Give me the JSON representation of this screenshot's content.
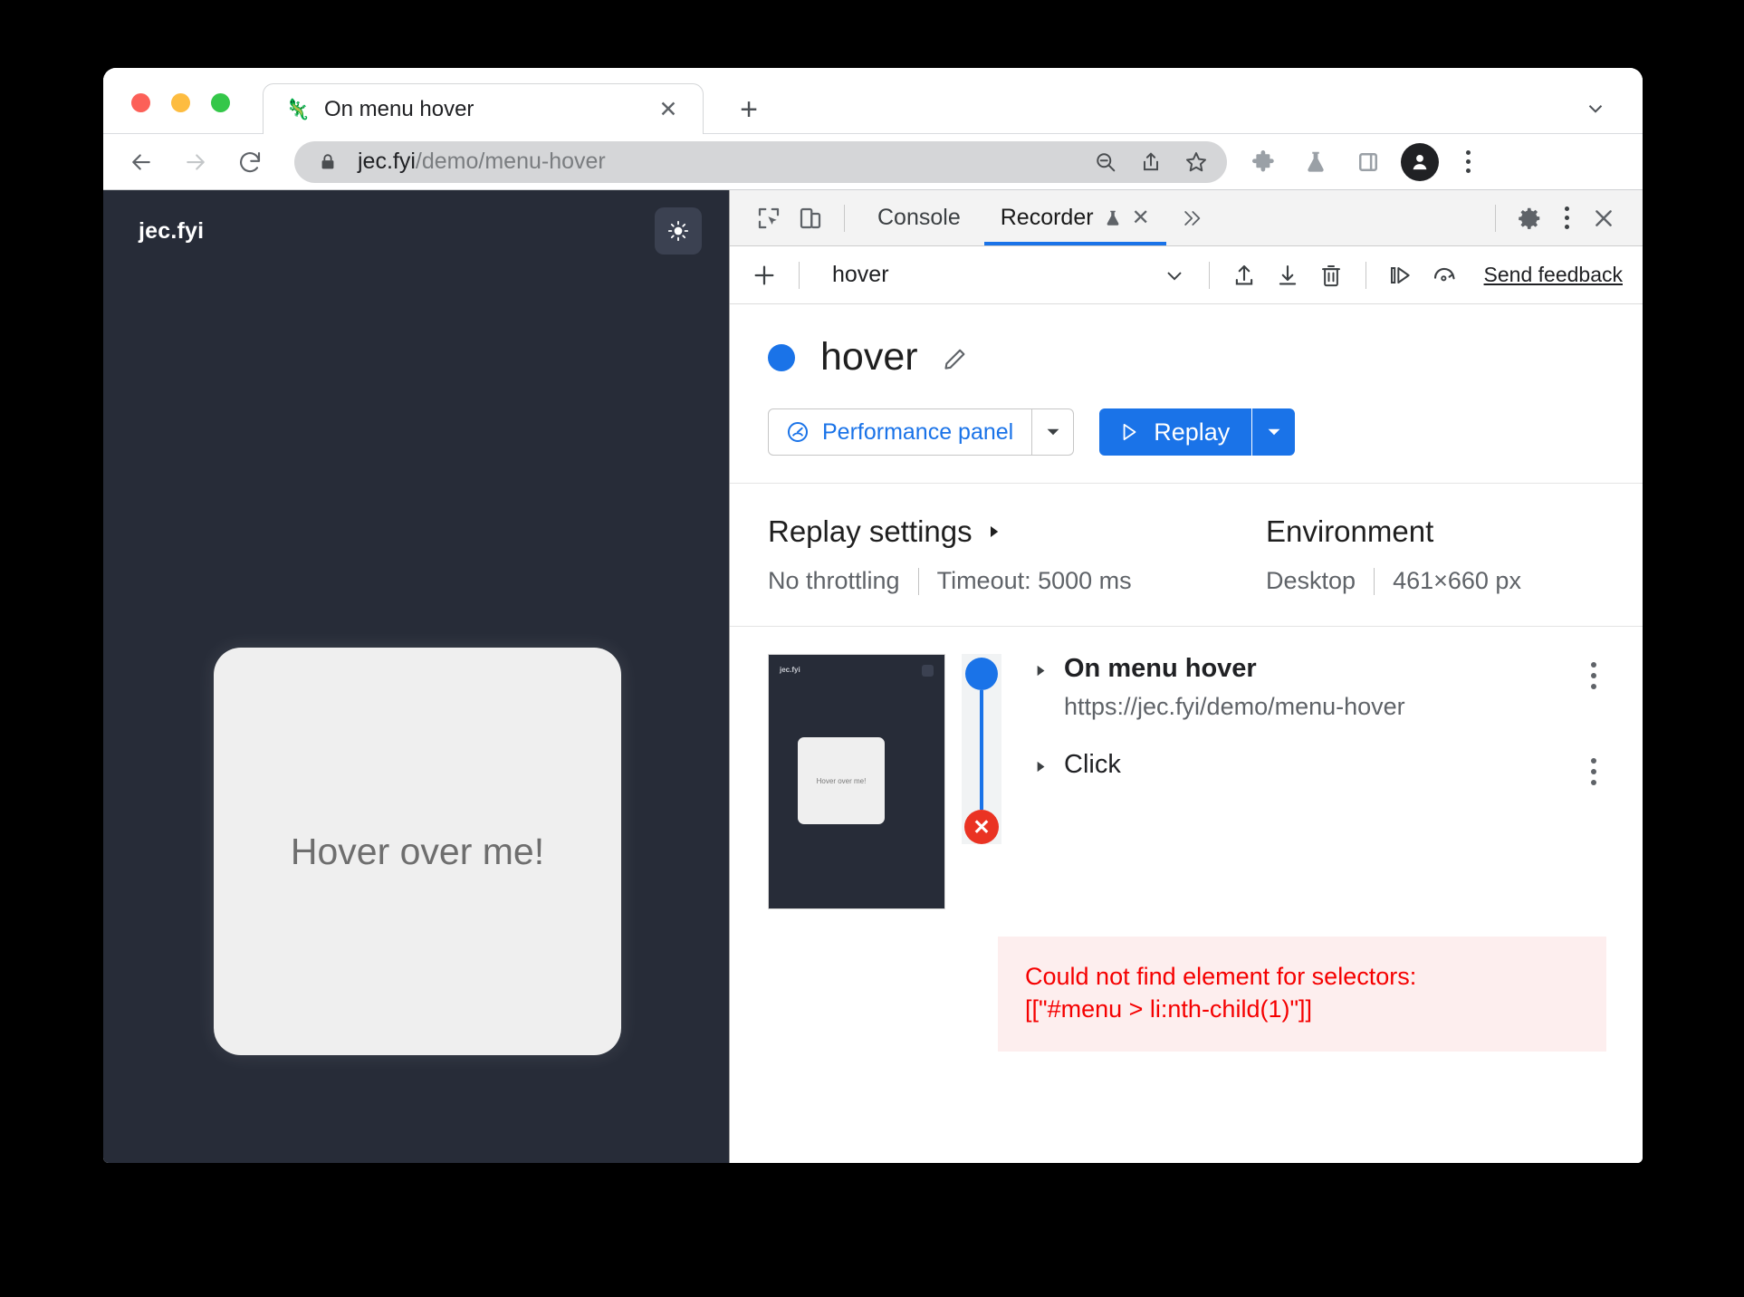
{
  "browser": {
    "tab": {
      "title": "On menu hover",
      "favicon_icon": "page-favicon",
      "close_icon": "close-icon"
    },
    "new_tab_label": "+",
    "tab_search_icon": "chevron-down-icon",
    "nav": {
      "back_icon": "back-arrow-icon",
      "forward_icon": "forward-arrow-icon",
      "reload_icon": "reload-icon"
    },
    "omnibox": {
      "lock_icon": "lock-icon",
      "url_host": "jec.fyi",
      "url_path": "/demo/menu-hover",
      "zoom_out_icon": "zoom-out-icon",
      "share_icon": "share-icon",
      "bookmark_icon": "star-icon"
    },
    "toolbar": {
      "extensions_icon": "puzzle-icon",
      "experiments_icon": "flask-icon",
      "side_panel_icon": "side-panel-icon",
      "profile_icon": "profile-avatar-icon",
      "menu_icon": "three-dot-menu-icon"
    }
  },
  "page": {
    "brand": "jec.fyi",
    "theme_toggle_icon": "sun-icon",
    "card_text": "Hover over me!",
    "background_color": "#272c38",
    "card_color": "#efefef"
  },
  "devtools": {
    "tabbar": {
      "inspect_icon": "inspect-element-icon",
      "device_toggle_icon": "device-toolbar-icon",
      "tabs": [
        {
          "label": "Console",
          "active": false
        },
        {
          "label": "Recorder",
          "active": true,
          "badge_icon": "flask-icon",
          "close_icon": "close-icon"
        }
      ],
      "more_tabs_icon": "chevron-double-right-icon",
      "settings_icon": "gear-icon",
      "menu_icon": "three-dot-menu-icon",
      "close_icon": "close-icon"
    },
    "recorder_toolbar": {
      "add_icon": "plus-icon",
      "recording_name": "hover",
      "dropdown_icon": "chevron-down-icon",
      "export_icon": "export-upload-icon",
      "import_icon": "import-download-icon",
      "delete_icon": "trash-icon",
      "step_over_icon": "step-over-play-icon",
      "replay_speed_icon": "replay-speed-icon",
      "feedback_label": "Send feedback"
    },
    "recording": {
      "status_dot_color": "#1a73e8",
      "title": "hover",
      "edit_icon": "pencil-edit-icon",
      "performance_button": {
        "label": "Performance panel",
        "icon": "performance-gauge-icon",
        "caret_icon": "chevron-down-icon"
      },
      "replay_button": {
        "label": "Replay",
        "icon": "play-triangle-icon",
        "caret_icon": "chevron-down-icon"
      }
    },
    "settings": {
      "replay_heading": "Replay settings",
      "replay_caret_icon": "triangle-right-icon",
      "throttling": "No throttling",
      "timeout": "Timeout: 5000 ms",
      "environment_heading": "Environment",
      "device": "Desktop",
      "viewport": "461×660 px"
    },
    "steps": {
      "thumbnail": {
        "brand": "jec.fyi",
        "card_text": "Hover over me!"
      },
      "rail": {
        "start_node_color": "#1a73e8",
        "end_node_color": "#ea3323",
        "end_node_icon": "error-x-icon"
      },
      "items": [
        {
          "caret_icon": "triangle-right-icon",
          "title": "On menu hover",
          "url": "https://jec.fyi/demo/menu-hover",
          "menu_icon": "three-dot-menu-icon"
        },
        {
          "caret_icon": "triangle-right-icon",
          "title": "Click",
          "menu_icon": "three-dot-menu-icon"
        }
      ],
      "error": {
        "line1": "Could not find element for selectors:",
        "line2": "[[\"#menu > li:nth-child(1)\"]]",
        "text_color": "#f50000",
        "background_color": "#fdeeee"
      }
    }
  }
}
